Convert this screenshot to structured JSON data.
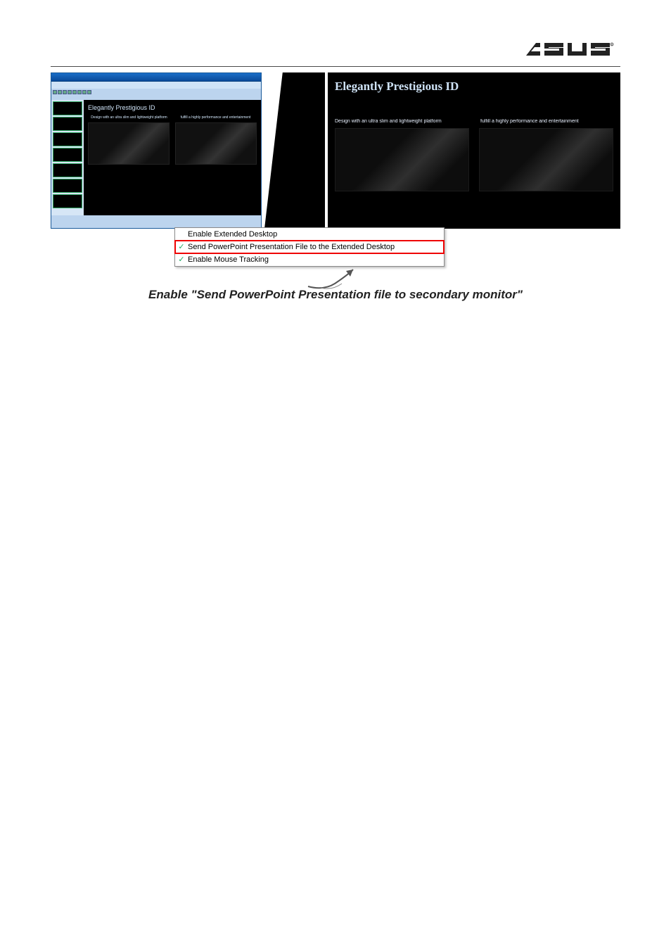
{
  "logo_alt": "ASUS",
  "powerpoint": {
    "slide_title": "Elegantly Prestigious ID",
    "caption_left": "Design with an ultra slim and lightweight platform",
    "caption_right": "fulfill a highly performance and entertainment"
  },
  "extended_preview": {
    "title": "Elegantly Prestigious ID",
    "caption_left": "Design with an ultra slim and lightweight platform",
    "caption_right": "fulfill a highly performance and entertainment"
  },
  "context_menu": {
    "items": [
      {
        "label": "Enable Extended Desktop",
        "checked": false
      },
      {
        "label": "Send PowerPoint Presentation File to the Extended Desktop",
        "checked": true
      },
      {
        "label": "Enable Mouse Tracking",
        "checked": true
      }
    ],
    "highlighted_index": 1
  },
  "figure_caption": "Enable \"Send PowerPoint Presentation file to secondary monitor\""
}
